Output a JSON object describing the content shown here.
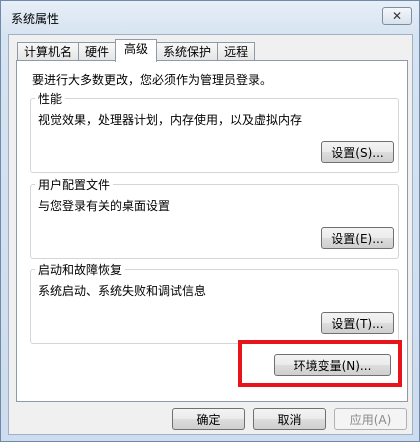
{
  "window": {
    "title": "系统属性",
    "close_glyph": "✕"
  },
  "tabs": [
    "计算机名",
    "硬件",
    "高级",
    "系统保护",
    "远程"
  ],
  "intro_text": "要进行大多数更改，您必须作为管理员登录。",
  "groups": [
    {
      "legend": "性能",
      "description": "视觉效果，处理器计划，内存使用，以及虚拟内存",
      "button": "设置(S)..."
    },
    {
      "legend": "用户配置文件",
      "description": "与您登录有关的桌面设置",
      "button": "设置(E)..."
    },
    {
      "legend": "启动和故障恢复",
      "description": "系统启动、系统失败和调试信息",
      "button": "设置(T)..."
    }
  ],
  "env_button": "环境变量(N)...",
  "footer": {
    "ok": "确定",
    "cancel": "取消",
    "apply": "应用(A)"
  },
  "colors": {
    "highlight": "#e8141a"
  }
}
